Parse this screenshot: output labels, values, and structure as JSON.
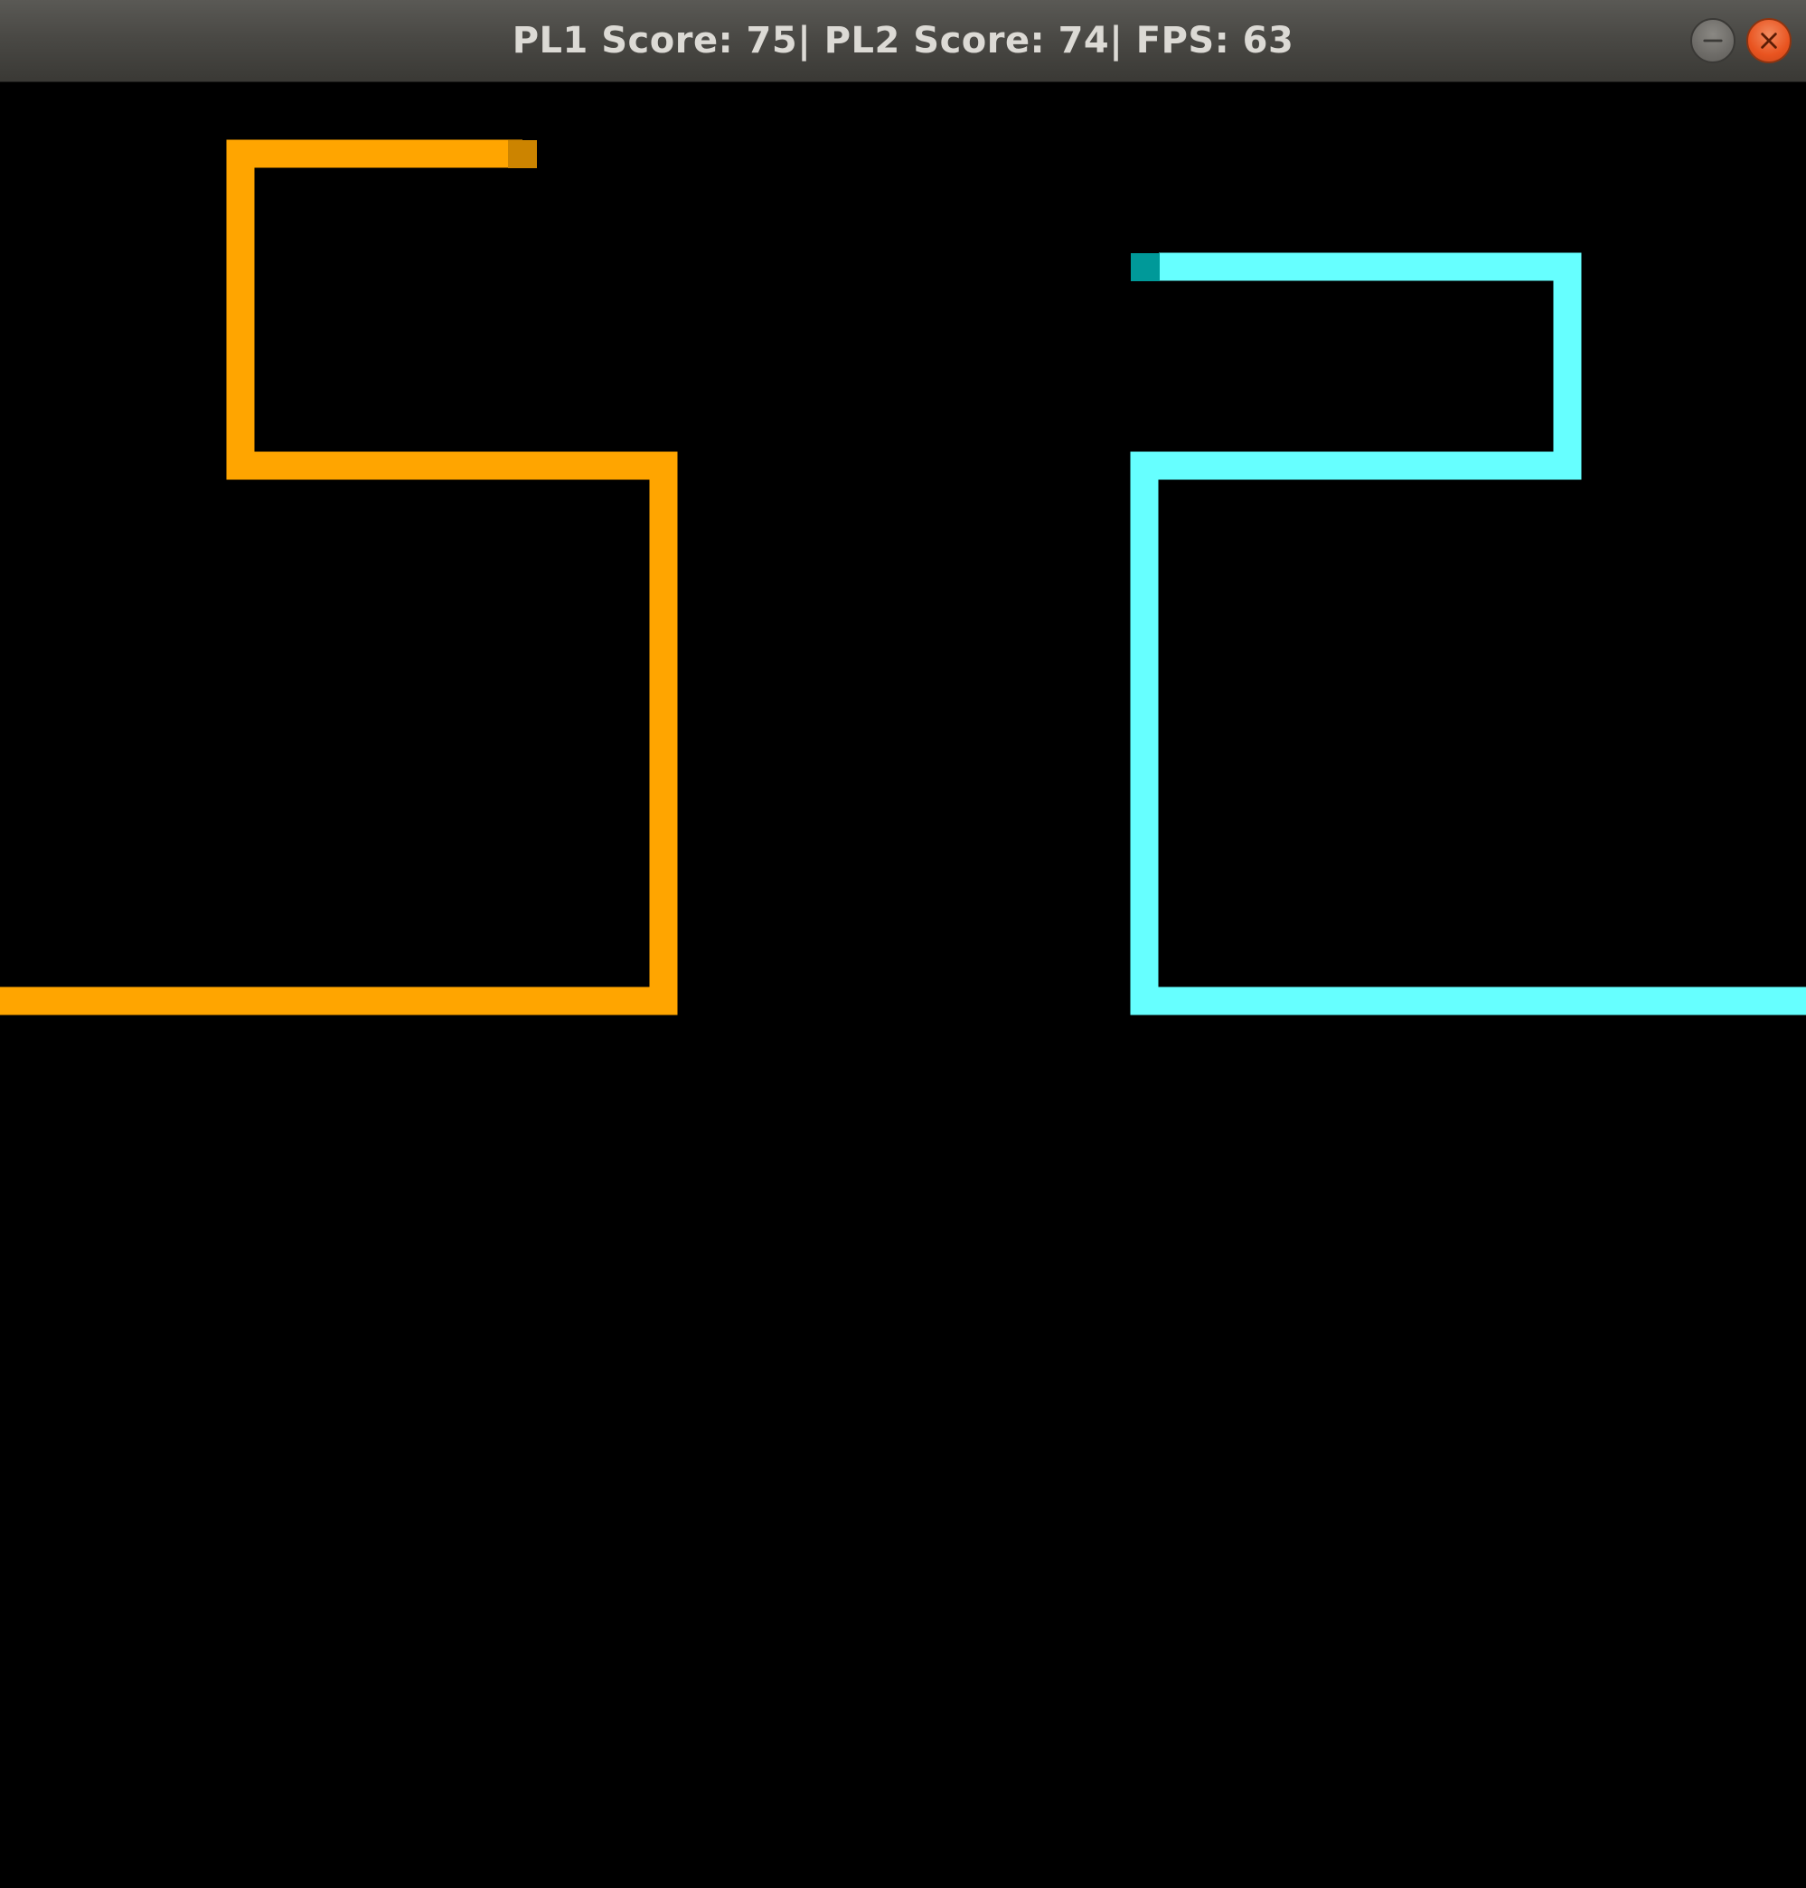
{
  "window": {
    "title": "PL1 Score: 75| PL2 Score: 74| FPS: 63",
    "buttons": [
      {
        "name": "minimize",
        "icon": "minimize-icon"
      },
      {
        "name": "close",
        "icon": "close-icon"
      }
    ]
  },
  "hud": {
    "pl1_score": 75,
    "pl2_score": 74,
    "fps": 63
  },
  "players": [
    {
      "id": "PL1",
      "trail_color": "#FFA500",
      "head_color": "#CC8400"
    },
    {
      "id": "PL2",
      "trail_color": "#66FFFF",
      "head_color": "#009999"
    }
  ],
  "colors": {
    "background": "#000000",
    "titlebar": "#4a4945",
    "title_text": "#dcdad5",
    "close_button": "#e95420",
    "minimize_button": "#6e6c68"
  }
}
